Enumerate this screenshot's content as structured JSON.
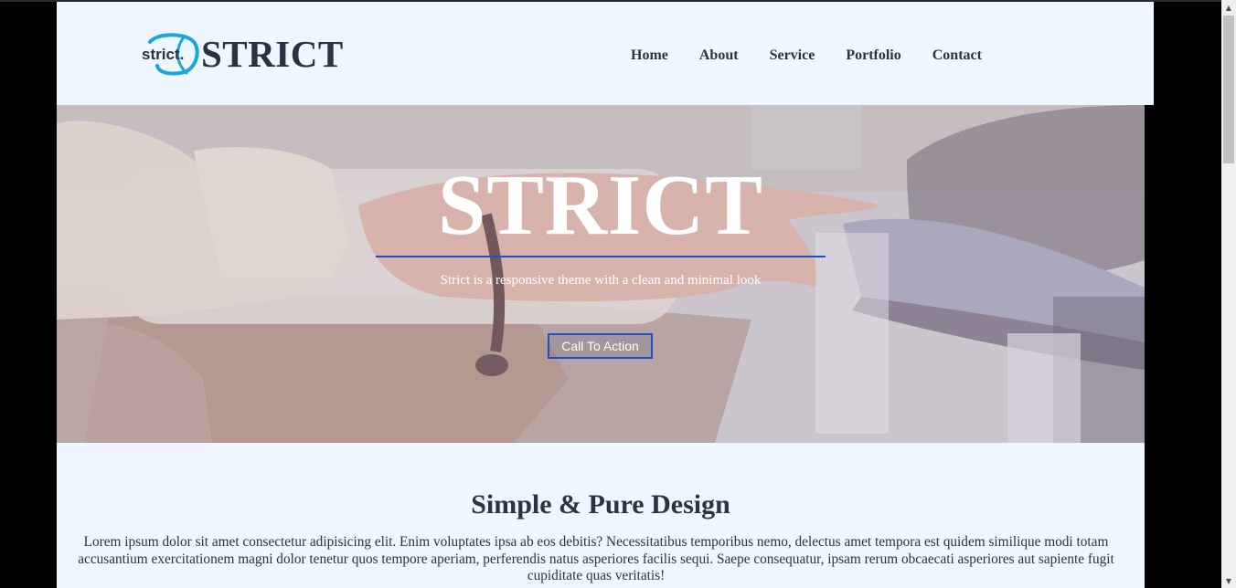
{
  "header": {
    "logo_text": "strict.",
    "brand_name": "STRICT",
    "nav": [
      "Home",
      "About",
      "Service",
      "Portfolio",
      "Contact"
    ]
  },
  "hero": {
    "title": "STRICT",
    "subtitle": "Strict is a responsive theme with a clean and minimal look",
    "cta_label": "Call To Action"
  },
  "content": {
    "heading": "Simple & Pure Design",
    "body": "Lorem ipsum dolor sit amet consectetur adipisicing elit. Enim voluptates ipsa ab eos debitis? Necessitatibus temporibus nemo, delectus amet tempora est quidem similique modi totam accusantium exercitationem magni dolor tenetur quos tempore aperiam, perferendis natus asperiores facilis sequi. Saepe consequatur, ipsam rerum obcaecati asperiores aut sapiente fugit cupiditate quas veritatis!"
  },
  "colors": {
    "accent": "#1f4fd1",
    "logo_accent": "#1aa7d6",
    "text": "#2a3342",
    "background": "#eef7ff"
  },
  "icons": {
    "scroll_up": "scroll-up-arrow-icon",
    "scroll_down": "scroll-down-arrow-icon"
  }
}
